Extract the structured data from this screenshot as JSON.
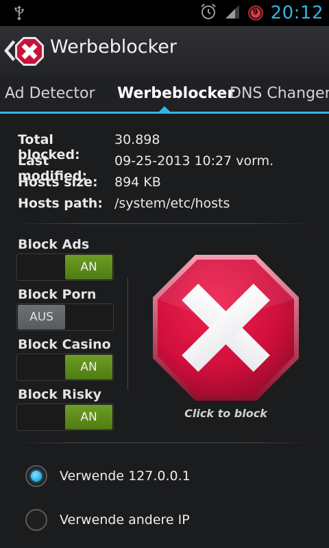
{
  "status_bar": {
    "time": "20:12",
    "notification_count": "9",
    "icons": [
      "usb-icon",
      "alarm-icon",
      "signal-icon",
      "notification-badge-icon"
    ]
  },
  "action_bar": {
    "title": "Werbeblocker",
    "icons": [
      "back-chevron-icon",
      "app-logo-icon"
    ]
  },
  "tabs": [
    {
      "label": "Ad Detector",
      "active": false
    },
    {
      "label": "Werbeblocker",
      "active": true
    },
    {
      "label": "DNS Changer",
      "active": false
    }
  ],
  "info": [
    {
      "key": "Total blocked:",
      "value": "30.898"
    },
    {
      "key": "Last modified:",
      "value": "09-25-2013 10:27 vorm."
    },
    {
      "key": "Hosts size:",
      "value": "894 KB"
    },
    {
      "key": "Hosts path:",
      "value": "/system/etc/hosts"
    }
  ],
  "toggles": [
    {
      "label": "Block Ads",
      "state": "AN",
      "on": true
    },
    {
      "label": "Block Porn",
      "state": "AUS",
      "on": false
    },
    {
      "label": "Block Casino",
      "state": "AN",
      "on": true
    },
    {
      "label": "Block Risky",
      "state": "AN",
      "on": true
    }
  ],
  "block_button": {
    "caption": "Click to block",
    "icon": "stop-sign-x-icon"
  },
  "radios": [
    {
      "label": "Verwende 127.0.0.1",
      "checked": true
    },
    {
      "label": "Verwende andere IP",
      "checked": false
    }
  ],
  "colors": {
    "accent": "#33b5e5",
    "toggle_on": "#5e8d1b",
    "toggle_off": "#62666b",
    "stop_red": "#d6123f",
    "background": "#1b1c1e"
  }
}
